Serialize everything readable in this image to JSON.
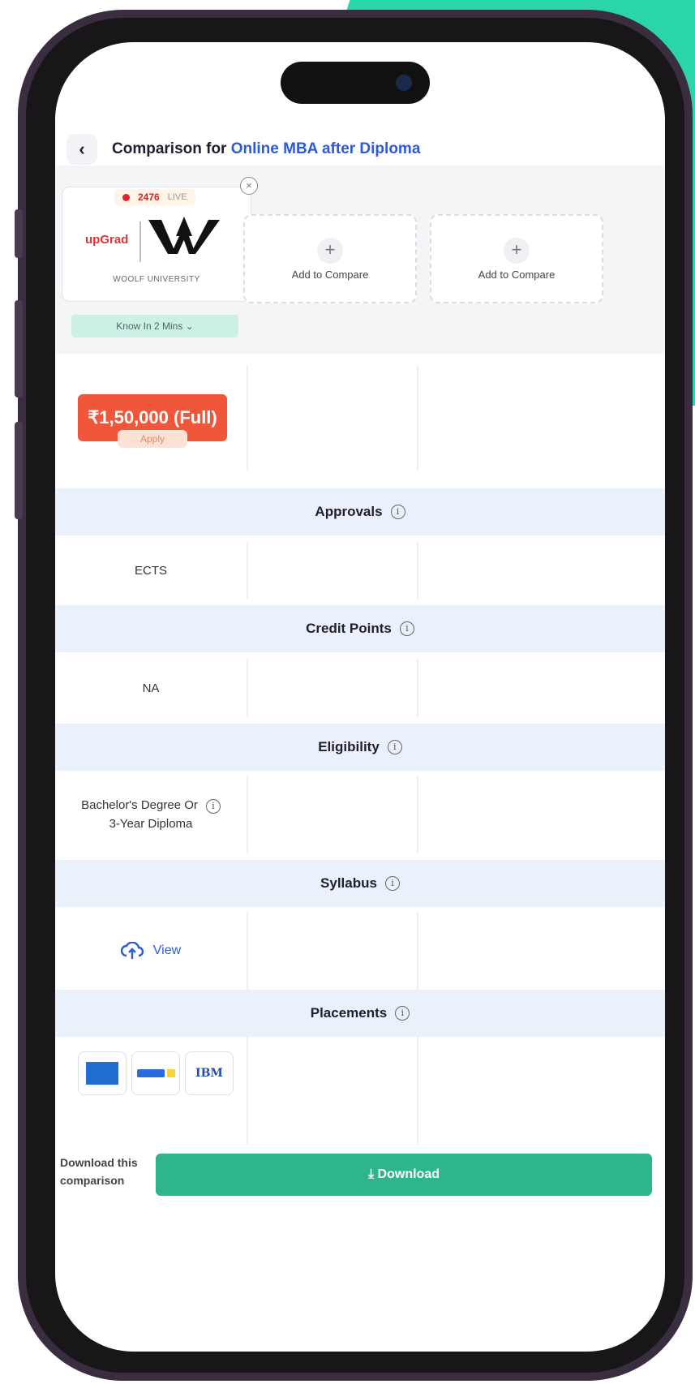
{
  "header": {
    "back_glyph": "‹",
    "title_prefix": "Comparison for ",
    "title_highlight": "Online MBA after Diploma"
  },
  "university_card": {
    "live_count": "2476",
    "live_label": "LIVE",
    "partner_logo": "upGrad",
    "university_name": "WOOLF UNIVERSITY",
    "know_button": "Know In 2 Mins",
    "price": "₹1,50,000 (Full)",
    "apply_label": "Apply"
  },
  "add_slots": [
    {
      "label": "Add to Compare"
    },
    {
      "label": "Add to Compare"
    }
  ],
  "sections": {
    "approvals": {
      "heading": "Approvals",
      "value": "ECTS"
    },
    "credit_points": {
      "heading": "Credit Points",
      "value": "NA"
    },
    "eligibility": {
      "heading": "Eligibility",
      "value_line1": "Bachelor's Degree Or",
      "value_line2": "3-Year Diploma"
    },
    "syllabus": {
      "heading": "Syllabus",
      "value": "View"
    },
    "placements": {
      "heading": "Placements",
      "logos": [
        "american-express-logo",
        "flipkart-logo",
        "ibm-logo"
      ],
      "ibm_text": "IBM"
    }
  },
  "download": {
    "prompt_line1": "Download this",
    "prompt_line2": "comparison",
    "button_label": "Download"
  },
  "colors": {
    "accent_green": "#2ad6a8",
    "price_orange": "#f0573a",
    "download_green": "#2fb58c",
    "link_blue": "#2d5bd7",
    "section_bg": "#eaf1fb"
  }
}
